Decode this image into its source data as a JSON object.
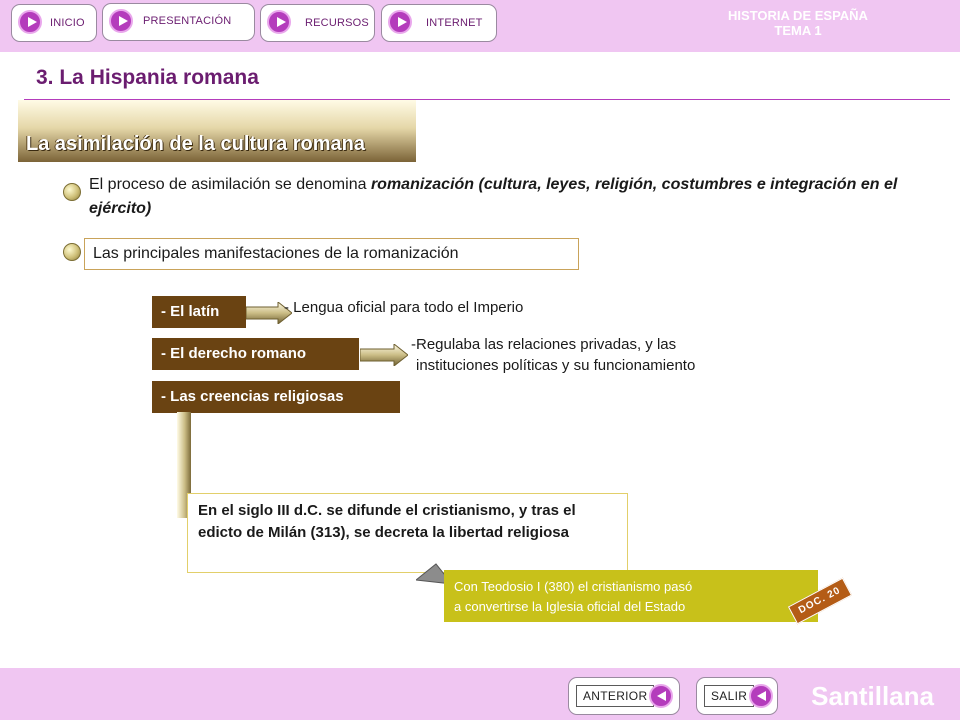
{
  "header": {
    "nav": [
      "INICIO",
      "PRESENTACIÓN",
      "RECURSOS",
      "INTERNET"
    ],
    "title_line1": "HISTORIA DE ESPAÑA",
    "title_line2": "TEMA 1"
  },
  "section_title": "3. La Hispania romana",
  "banner": "La asimilación de la cultura romana",
  "intro": {
    "text": "El proceso de asimilación se denomina ",
    "emphasis": "romanización (cultura, leyes, religión, costumbres e integración en el ejército)"
  },
  "manifestations_title": "Las principales manifestaciones de la romanización",
  "items": [
    {
      "label": "- El latín",
      "desc": "- Lengua oficial para todo el Imperio"
    },
    {
      "label": "- El derecho romano",
      "desc_line1": "-Regulaba las relaciones privadas, y las",
      "desc_line2": "instituciones políticas y su funcionamiento"
    },
    {
      "label": "- Las creencias religiosas"
    }
  ],
  "christianity": "En el siglo III d.C. se difunde el cristianismo, y tras el edicto de Milán (313), se decreta la libertad religiosa",
  "note_line1": "Con Teodosio I (380) el cristianismo pasó",
  "note_line2": "a convertirse la Iglesia oficial del Estado",
  "doc_tag": "DOC. 20",
  "footer": {
    "prev": "ANTERIOR",
    "exit": "SALIR",
    "brand": "Santillana"
  }
}
